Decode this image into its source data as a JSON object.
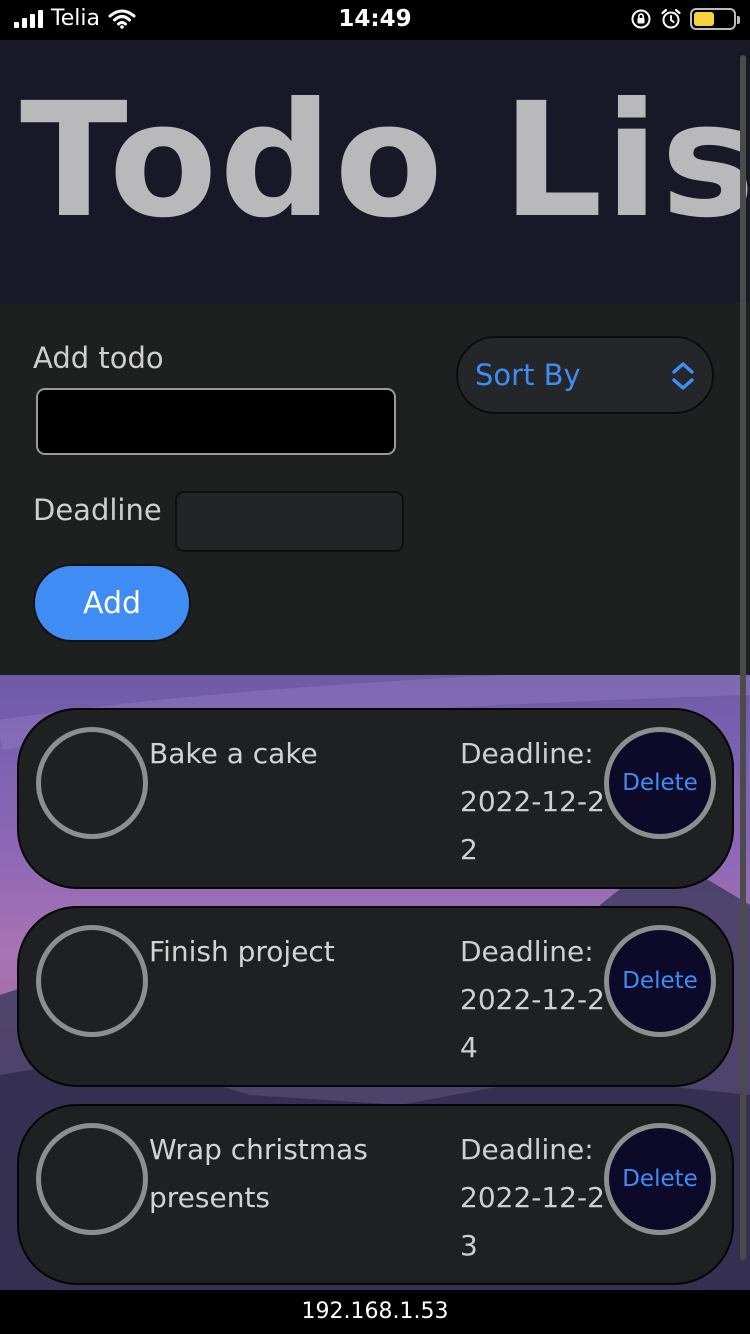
{
  "status_bar": {
    "carrier": "Telia",
    "time": "14:49"
  },
  "header": {
    "title": "Todo List"
  },
  "form": {
    "add_todo_label": "Add todo",
    "todo_input_value": "",
    "deadline_label": "Deadline",
    "deadline_value": "",
    "add_button_label": "Add",
    "sort_label": "Sort By"
  },
  "todos": [
    {
      "text": "Bake a cake",
      "deadline": "Deadline: 2022-12-22",
      "delete_label": "Delete"
    },
    {
      "text": "Finish project",
      "deadline": "Deadline: 2022-12-24",
      "delete_label": "Delete"
    },
    {
      "text": "Wrap christmas presents",
      "deadline": "Deadline: 2022-12-23",
      "delete_label": "Delete"
    }
  ],
  "browser": {
    "url": "192.168.1.53"
  },
  "colors": {
    "accent": "#3f8cf5",
    "header_bg": "#181827",
    "panel_bg": "#1e1f1f",
    "card_bg": "#1f2021",
    "battery": "#f5d341"
  },
  "icons": {
    "signal": "signal-bars-icon",
    "wifi": "wifi-icon",
    "orientation_lock": "rotation-lock-icon",
    "alarm": "alarm-icon",
    "battery": "battery-icon",
    "sort": "chevron-up-down-icon"
  }
}
